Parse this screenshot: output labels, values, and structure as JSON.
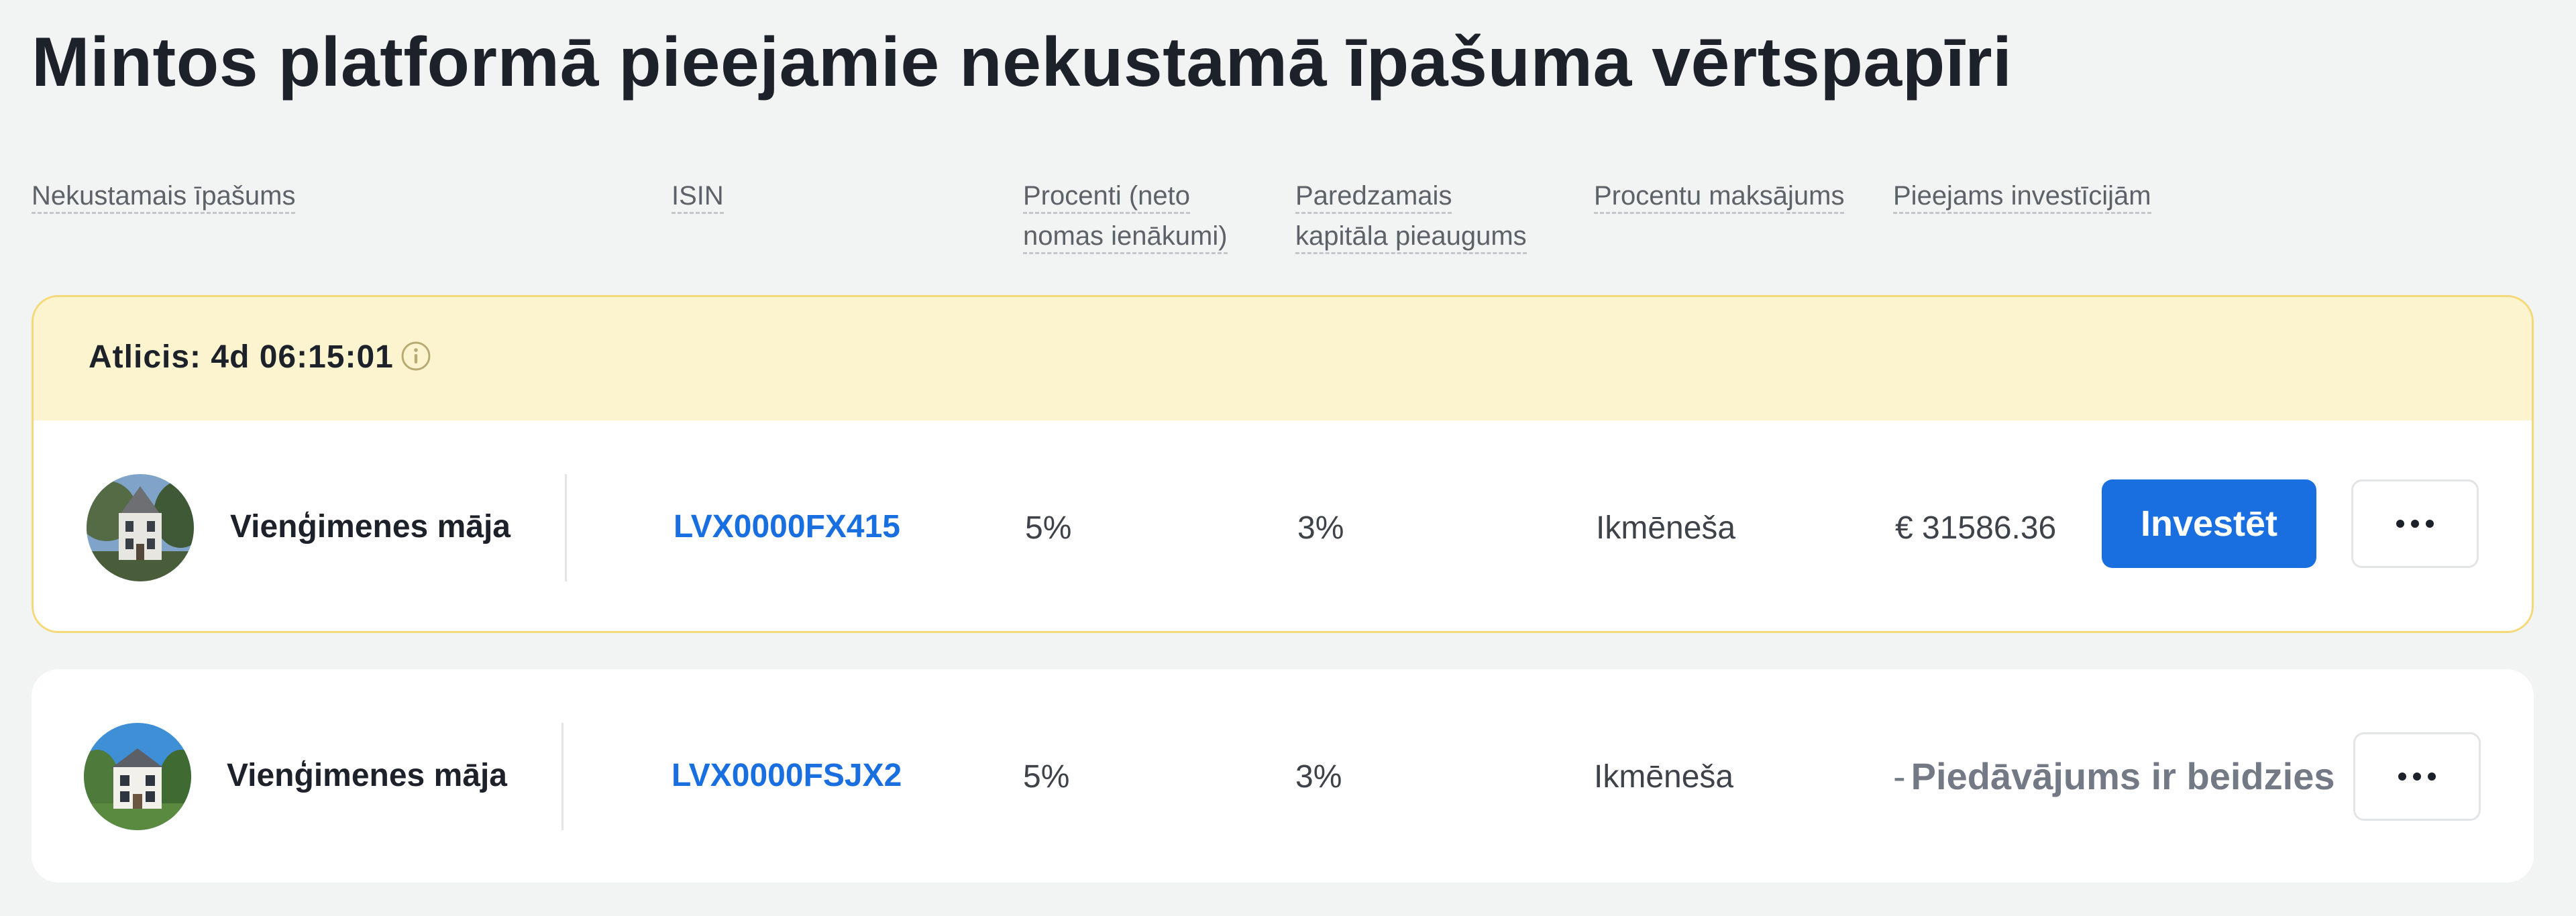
{
  "page": {
    "title": "Mintos platformā pieejamie nekustamā īpašuma vērtspapīri"
  },
  "columns": {
    "property": "Nekustamais īpašums",
    "isin": "ISIN",
    "interest_line1": "Procenti (neto",
    "interest_line2": "nomas ienākumi)",
    "growth_line1": "Paredzamais",
    "growth_line2": "kapitāla pieaugums",
    "payments": "Procentu maksājums",
    "available": "Pieejams investīcijām"
  },
  "listings": [
    {
      "timer": "Atlicis: 4d 06:15:01",
      "property_name": "Vienģimenes māja",
      "isin": "LVX0000FX415",
      "interest": "5%",
      "growth": "3%",
      "payment_frequency": "Ikmēneša",
      "available": "€ 31586.36",
      "invest_label": "Investēt"
    },
    {
      "property_name": "Vienģimenes māja",
      "isin": "LVX0000FSJX2",
      "interest": "5%",
      "growth": "3%",
      "payment_frequency": "Ikmēneša",
      "dash": "-",
      "status": "Piedāvājums ir beidzies"
    }
  ],
  "icons": {
    "timer_info": "info-icon",
    "more": "more-dots-icon",
    "avatar": "house-photo"
  },
  "colors": {
    "accent": "#1a6fe0",
    "timer_bg": "#fcf4cf",
    "timer_border": "#f3d978",
    "page_bg": "#f1f4f3"
  }
}
